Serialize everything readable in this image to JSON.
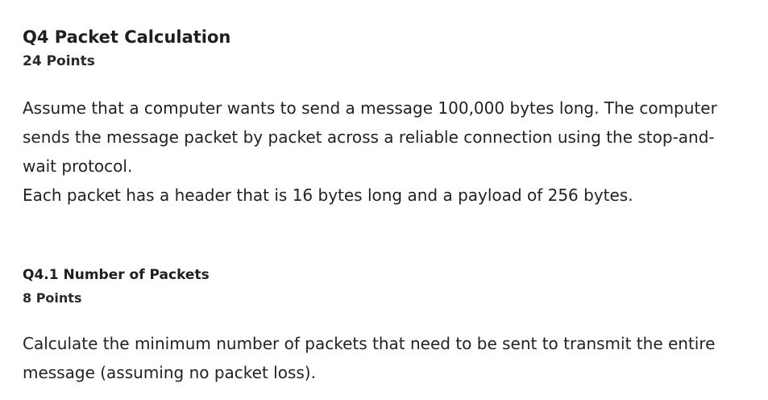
{
  "question": {
    "title": "Q4 Packet Calculation",
    "points": "24 Points",
    "paragraph1": "Assume that a computer wants to send a message 100,000 bytes long. The computer sends the message packet by packet across a reliable connection using the stop-and-wait protocol.",
    "paragraph2": "Each packet has a header that is 16 bytes long and a payload of 256 bytes."
  },
  "subquestion": {
    "title": "Q4.1 Number of Packets",
    "points": "8 Points",
    "body": "Calculate the minimum number of packets that need to be sent to transmit the entire message (assuming no packet loss)."
  }
}
